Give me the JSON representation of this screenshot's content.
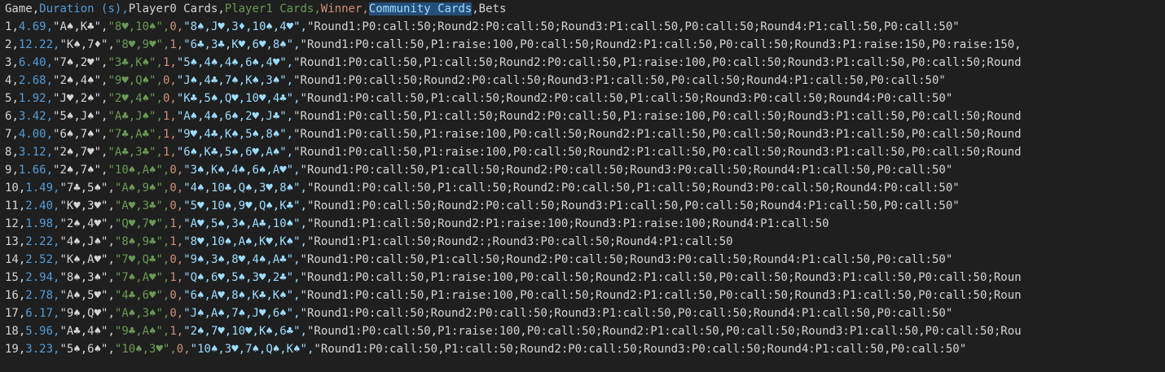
{
  "header": {
    "game": "Game",
    "duration": "Duration (s)",
    "p0cards": "Player0 Cards",
    "p1cards": "Player1 Cards",
    "winner": "Winner",
    "community": "Community Cards",
    "bets": "Bets"
  },
  "rows": [
    {
      "game": "1",
      "dur": "4.69",
      "p0": "\"A♠,K♣\"",
      "p1": "\"8♥,10♠\"",
      "win": "0",
      "comm": "\"8♠,J♥,3♦,10♠,4♥\"",
      "bets": "\"Round1:P0:call:50;Round2:P0:call:50;Round3:P1:call:50,P0:call:50;Round4:P1:call:50,P0:call:50\""
    },
    {
      "game": "2",
      "dur": "12.22",
      "p0": "\"K♠,7♦\"",
      "p1": "\"8♥,9♥\"",
      "win": "1",
      "comm": "\"6♣,3♣,K♥,6♥,8♠\"",
      "bets": "\"Round1:P0:call:50,P1:raise:100,P0:call:50;Round2:P1:call:50,P0:call:50;Round3:P1:raise:150,P0:raise:150,"
    },
    {
      "game": "3",
      "dur": "6.40",
      "p0": "\"7♠,2♥\"",
      "p1": "\"3♣,K♠\"",
      "win": "1",
      "comm": "\"5♠,4♠,4♠,6♠,4♥\"",
      "bets": "\"Round1:P0:call:50,P1:call:50;Round2:P0:call:50,P1:raise:100,P0:call:50;Round3:P1:call:50,P0:call:50;Round"
    },
    {
      "game": "4",
      "dur": "2.68",
      "p0": "\"2♠,4♠\"",
      "p1": "\"9♥,Q♠\"",
      "win": "0",
      "comm": "\"J♠,4♣,7♠,K♠,3♠\"",
      "bets": "\"Round1:P0:call:50;Round2:P0:call:50;Round3:P1:call:50,P0:call:50;Round4:P1:call:50,P0:call:50\""
    },
    {
      "game": "5",
      "dur": "1.92",
      "p0": "\"J♥,2♠\"",
      "p1": "\"2♥,4♠\"",
      "win": "0",
      "comm": "\"K♣,5♠,Q♥,10♥,4♣\"",
      "bets": "\"Round1:P0:call:50,P1:call:50;Round2:P0:call:50,P1:call:50;Round3:P0:call:50;Round4:P0:call:50\""
    },
    {
      "game": "6",
      "dur": "3.42",
      "p0": "\"5♠,J♠\"",
      "p1": "\"A♣,J♠\"",
      "win": "1",
      "comm": "\"A♠,4♠,6♠,2♥,J♣\"",
      "bets": "\"Round1:P0:call:50,P1:call:50;Round2:P0:call:50,P1:raise:100,P0:call:50;Round3:P1:call:50,P0:call:50;Round"
    },
    {
      "game": "7",
      "dur": "4.00",
      "p0": "\"6♠,7♠\"",
      "p1": "\"7♣,A♣\"",
      "win": "1",
      "comm": "\"9♥,4♣,K♠,5♠,8♠\"",
      "bets": "\"Round1:P0:call:50,P1:raise:100,P0:call:50;Round2:P1:call:50,P0:call:50;Round3:P1:call:50,P0:call:50;Round"
    },
    {
      "game": "8",
      "dur": "3.12",
      "p0": "\"2♠,7♥\"",
      "p1": "\"A♣,3♣\"",
      "win": "1",
      "comm": "\"6♠,K♣,5♠,6♥,A♠\"",
      "bets": "\"Round1:P0:call:50,P1:raise:100,P0:call:50;Round2:P1:call:50,P0:call:50;Round3:P1:call:50,P0:call:50;Round"
    },
    {
      "game": "9",
      "dur": "1.66",
      "p0": "\"2♠,7♠\"",
      "p1": "\"10♠,A♠\"",
      "win": "0",
      "comm": "\"3♠,K♠,4♠,6♠,A♥\"",
      "bets": "\"Round1:P0:call:50,P1:call:50;Round2:P0:call:50;Round3:P0:call:50;Round4:P1:call:50,P0:call:50\""
    },
    {
      "game": "10",
      "dur": "1.49",
      "p0": "\"7♣,5♠\"",
      "p1": "\"A♠,9♠\"",
      "win": "0",
      "comm": "\"4♠,10♣,Q♠,3♥,8♠\"",
      "bets": "\"Round1:P0:call:50,P1:call:50;Round2:P0:call:50,P1:call:50;Round3:P0:call:50;Round4:P0:call:50\""
    },
    {
      "game": "11",
      "dur": "2.40",
      "p0": "\"K♥,3♥\"",
      "p1": "\"A♥,3♣\"",
      "win": "0",
      "comm": "\"5♥,10♠,9♥,Q♠,K♣\"",
      "bets": "\"Round1:P0:call:50;Round2:P0:call:50;Round3:P1:call:50,P0:call:50;Round4:P1:call:50,P0:call:50\""
    },
    {
      "game": "12",
      "dur": "1.98",
      "p0": "\"2♠,4♥\"",
      "p1": "\"Q♥,7♥\"",
      "win": "1",
      "comm": "\"A♥,5♠,3♠,A♣,10♠\"",
      "bets": "\"Round1:P1:call:50;Round2:P1:raise:100;Round3:P1:raise:100;Round4:P1:call:50"
    },
    {
      "game": "13",
      "dur": "2.22",
      "p0": "\"4♠,J♠\"",
      "p1": "\"8♠,9♣\"",
      "win": "1",
      "comm": "\"8♥,10♠,A♠,K♥,K♠\"",
      "bets": "\"Round1:P1:call:50;Round2:;Round3:P0:call:50;Round4:P1:call:50"
    },
    {
      "game": "14",
      "dur": "2.52",
      "p0": "\"K♠,A♥\"",
      "p1": "\"7♥,Q♣\"",
      "win": "0",
      "comm": "\"9♠,3♠,8♥,4♠,A♣\"",
      "bets": "\"Round1:P0:call:50,P1:call:50;Round2:P0:call:50;Round3:P0:call:50;Round4:P1:call:50,P0:call:50\""
    },
    {
      "game": "15",
      "dur": "2.94",
      "p0": "\"8♠,3♠\"",
      "p1": "\"7♠,A♥\"",
      "win": "1",
      "comm": "\"Q♠,6♥,5♠,3♥,2♣\"",
      "bets": "\"Round1:P0:call:50,P1:raise:100,P0:call:50;Round2:P1:call:50,P0:call:50;Round3:P1:call:50,P0:call:50;Roun"
    },
    {
      "game": "16",
      "dur": "2.78",
      "p0": "\"A♠,5♥\"",
      "p1": "\"4♣,6♥\"",
      "win": "0",
      "comm": "\"6♠,A♥,8♠,K♣,K♠\"",
      "bets": "\"Round1:P0:call:50,P1:raise:100,P0:call:50;Round2:P1:call:50,P0:call:50;Round3:P1:call:50,P0:call:50;Roun"
    },
    {
      "game": "17",
      "dur": "6.17",
      "p0": "\"9♠,Q♥\"",
      "p1": "\"A♠,3♠\"",
      "win": "0",
      "comm": "\"J♠,A♠,7♠,J♥,6♠\"",
      "bets": "\"Round1:P0:call:50;Round2:P0:call:50;Round3:P1:call:50,P0:call:50;Round4:P1:call:50,P0:call:50\""
    },
    {
      "game": "18",
      "dur": "5.96",
      "p0": "\"A♣,4♠\"",
      "p1": "\"9♣,A♠\"",
      "win": "1",
      "comm": "\"2♠,7♥,10♥,K♠,6♣\"",
      "bets": "\"Round1:P0:call:50,P1:raise:100,P0:call:50;Round2:P1:call:50,P0:call:50;Round3:P1:call:50,P0:call:50;Rou"
    },
    {
      "game": "19",
      "dur": "3.23",
      "p0": "\"5♠,6♠\"",
      "p1": "\"10♠,3♥\"",
      "win": "0",
      "comm": "\"10♠,3♥,7♠,Q♠,K♠\"",
      "bets": "\"Round1:P0:call:50,P1:call:50;Round2:P0:call:50;Round3:P0:call:50;Round4:P1:call:50,P0:call:50\""
    }
  ],
  "colors": {
    "background": "#1f1f1f",
    "col1": "#d4d4d4",
    "col2": "#569cd6",
    "col3": "#d4d4d4",
    "col4": "#6a9955",
    "col5": "#ce9178",
    "col6": "#9cdcfe",
    "col6_highlight_bg": "#264f78",
    "col7": "#d4d4d4"
  }
}
